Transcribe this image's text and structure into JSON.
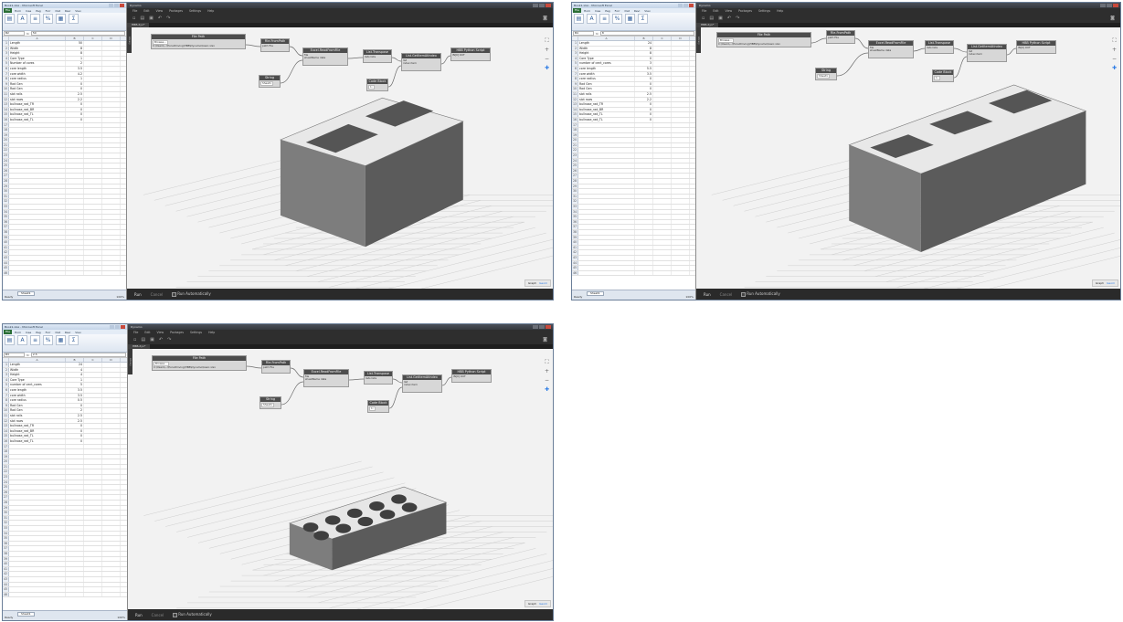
{
  "excel": {
    "ribbon_tabs": [
      "File",
      "Hom",
      "Inse",
      "Pag",
      "Forr",
      "Dat",
      "Revi",
      "Viev"
    ],
    "column_headers": [
      "A",
      "B",
      "C",
      "D"
    ],
    "status_ready": "Ready",
    "sheet_tab": "Sheet1",
    "zoom": "100%"
  },
  "dynamo": {
    "window_title": "Dynamo",
    "menu_items": [
      "File",
      "Edit",
      "View",
      "Packages",
      "Settings",
      "Help"
    ],
    "file_tab": "HBB.dyn*",
    "library_tab": "Library",
    "run_button": "Run",
    "cancel_button": "Cancel",
    "run_auto_label": "Run Automatically",
    "geometry_toggle": [
      "Graph",
      "Geom"
    ],
    "nodes": {
      "file_path": {
        "title": "File Path",
        "browse": "Browse...",
        "path": "C:\\Users\\...\\ExcelDriving\\HBB\\Dynamo\\basic.xlsx"
      },
      "file_from_path": {
        "title": "File.FromPath",
        "in": "path",
        "out": "File"
      },
      "string": {
        "title": "String",
        "value": "Sheet1"
      },
      "read_excel": {
        "title": "Excel.ReadFromFile",
        "in1": "file",
        "in2": "sheetName",
        "out": "data"
      },
      "transpose": {
        "title": "List.Transpose",
        "in": "lists",
        "out": "lists"
      },
      "code_block": {
        "title": "Code Block",
        "value": "1;"
      },
      "get_item": {
        "title": "List.GetItemAtIndex",
        "in1": "list",
        "in2": "index",
        "out": "item"
      },
      "python": {
        "title": "HBB Python Script",
        "in": "IN[0]",
        "out": "OUT"
      }
    }
  },
  "screens": [
    {
      "label": "screen-1",
      "excel_title": "Book1.xlsx - Microsoft Excel",
      "name_box": "B2",
      "formula": "50",
      "rows": [
        [
          "Length",
          "50"
        ],
        [
          "Width",
          "8"
        ],
        [
          "Height",
          "8"
        ],
        [
          "Core Type",
          "1"
        ],
        [
          "Number of cores",
          "2"
        ],
        [
          "core length",
          "3.5"
        ],
        [
          "core width",
          "4.2"
        ],
        [
          "core radius",
          "1"
        ],
        [
          "Rad Gen",
          "0"
        ],
        [
          "Rad Gen",
          "0"
        ],
        [
          "slot rails",
          "2.5"
        ],
        [
          "slot rows",
          "2.2"
        ],
        [
          "bullnose_rad_TR",
          "0"
        ],
        [
          "bullnose_rad_BR",
          "0"
        ],
        [
          "bullnose_rad_TL",
          "0"
        ],
        [
          "bullnose_rad_TL",
          "0"
        ]
      ]
    },
    {
      "label": "screen-2",
      "excel_title": "Book1.xlsx - Microsoft Excel",
      "name_box": "B4",
      "formula": "8",
      "rows": [
        [
          "Length",
          "24"
        ],
        [
          "Width",
          "8"
        ],
        [
          "Height",
          "8"
        ],
        [
          "Core Type",
          "0"
        ],
        [
          "number of cent_cores",
          "3"
        ],
        [
          "core length",
          "5.5"
        ],
        [
          "core width",
          "3.5"
        ],
        [
          "core radius",
          "0"
        ],
        [
          "Rad Gen",
          "0"
        ],
        [
          "Rad Gen",
          "0"
        ],
        [
          "slot rails",
          "2.5"
        ],
        [
          "slot rows",
          "2.2"
        ],
        [
          "bullnose_rad_TR",
          "0"
        ],
        [
          "bullnose_rad_BR",
          "0"
        ],
        [
          "bullnose_rad_TL",
          "0"
        ],
        [
          "bullnose_rad_TL",
          "0"
        ]
      ]
    },
    {
      "label": "screen-3",
      "excel_title": "Book1.xlsx - Microsoft Excel",
      "name_box": "B3",
      "formula": "2.5",
      "rows": [
        [
          "Length",
          "24"
        ],
        [
          "Width",
          "4"
        ],
        [
          "Height",
          "4"
        ],
        [
          "Core Type",
          "1"
        ],
        [
          "number of cent_cores",
          "5"
        ],
        [
          "core length",
          "3.5"
        ],
        [
          "core width",
          "3.5"
        ],
        [
          "core radius",
          "0.5"
        ],
        [
          "Rad Gen",
          "0"
        ],
        [
          "Rad Gen",
          "2"
        ],
        [
          "slot rails",
          "2.5"
        ],
        [
          "slot rows",
          "2.5"
        ],
        [
          "bullnose_rad_TR",
          "0"
        ],
        [
          "bullnose_rad_BR",
          "0"
        ],
        [
          "bullnose_rad_TL",
          "0"
        ],
        [
          "bullnose_rad_TL",
          "0"
        ]
      ]
    }
  ]
}
